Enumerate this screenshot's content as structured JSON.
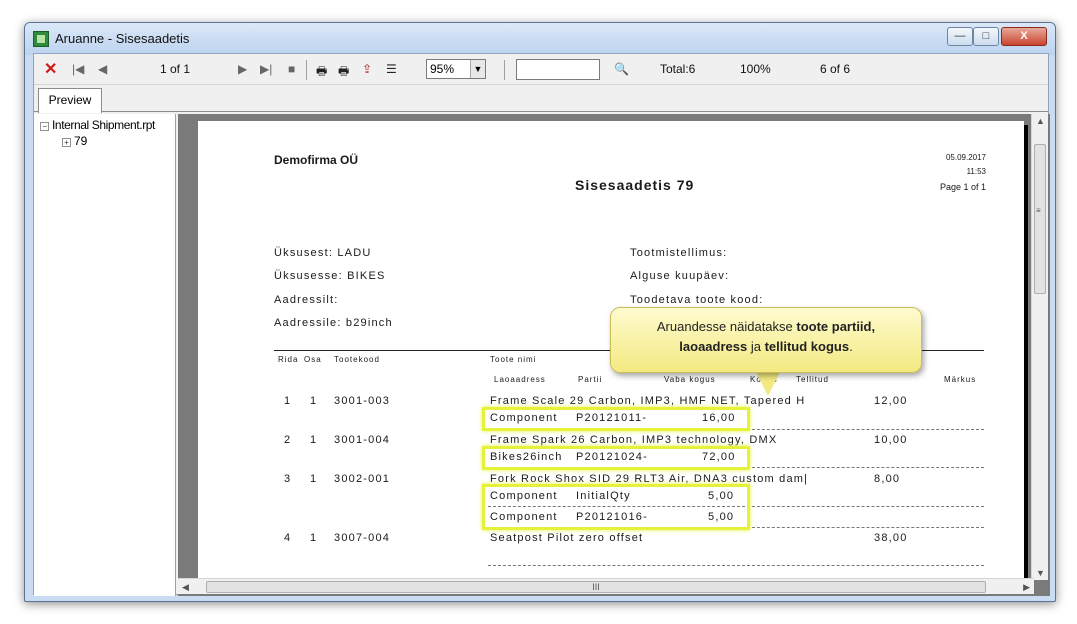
{
  "window": {
    "title": "Aruanne - Sisesaadetis"
  },
  "window_buttons": {
    "minimize": "—",
    "maximize": "□",
    "close": "X"
  },
  "toolbar": {
    "close": "✕",
    "first": "|◀",
    "prev": "◀",
    "page_position": "1 of 1",
    "next": "▶",
    "last": "▶|",
    "stop": "■",
    "print": "🖶",
    "print_setup": "🖶",
    "export": "⇪",
    "group_tree": "☰",
    "zoom": "95%",
    "search_value": "",
    "find": "🔍",
    "total": "Total:6",
    "percent": "100%",
    "count": "6 of 6"
  },
  "tabs": [
    {
      "label": "Preview"
    }
  ],
  "tree": {
    "root": "Internal Shipment.rpt",
    "child": "79",
    "expand_root": "−",
    "expand_child": "+"
  },
  "report": {
    "company": "Demofirma OÜ",
    "title": "Sisesaadetis  79",
    "date": "05.09.2017",
    "time": "11:53",
    "page": "Page 1 of 1",
    "fields_left": [
      "Üksusest: LADU",
      "Üksusesse: BIKES",
      "Aadressilt:",
      "Aadressile: b29inch"
    ],
    "fields_right": [
      "Tootmistellimus:",
      "Alguse kuupäev:",
      "Toodetava toote kood:"
    ],
    "columns": {
      "rida": "Rida",
      "osa": "Osa",
      "tootekood": "Tootekood",
      "nimi": "Toote nimi",
      "kogus": "Kogus",
      "markus": "Märkus"
    },
    "sub_columns": {
      "laoaadress": "Laoaadress",
      "partii": "Partii",
      "vaba": "Vaba kogus",
      "kogus": "Kogus",
      "tellitud": "Tellitud"
    },
    "rows": [
      {
        "rida": "1",
        "osa": "1",
        "code": "3001-003",
        "name": "Frame Scale 29 Carbon, IMP3, HMF NET, Tapered H",
        "qty": "12,00",
        "lots": [
          {
            "addr": "Component",
            "lot": "P20121011-",
            "free": "16,00"
          }
        ]
      },
      {
        "rida": "2",
        "osa": "1",
        "code": "3001-004",
        "name": "Frame Spark 26 Carbon, IMP3 technology, DMX",
        "qty": "10,00",
        "lots": [
          {
            "addr": "Bikes26inch",
            "lot": "P20121024-",
            "free": "72,00"
          }
        ]
      },
      {
        "rida": "3",
        "osa": "1",
        "code": "3002-001",
        "name": "Fork Rock Shox SID 29 RLT3 Air, DNA3 custom dam|",
        "qty": "8,00",
        "lots": [
          {
            "addr": "Component",
            "lot": "InitialQty",
            "free": "5,00"
          },
          {
            "addr": "Component",
            "lot": "P20121016-",
            "free": "5,00"
          }
        ]
      },
      {
        "rida": "4",
        "osa": "1",
        "code": "3007-004",
        "name": "Seatpost Pilot zero offset",
        "qty": "38,00",
        "lots": []
      }
    ]
  },
  "callout": {
    "pre": "Aruandesse näidatakse ",
    "b1": "toote partiid,",
    "b2": "laoaadress",
    "mid": " ja ",
    "b3": "tellitud kogus",
    "post": "."
  },
  "scroll": {
    "left": "◀",
    "right": "▶",
    "up": "▲",
    "down": "▼",
    "grip": "III",
    "side": "≡"
  }
}
